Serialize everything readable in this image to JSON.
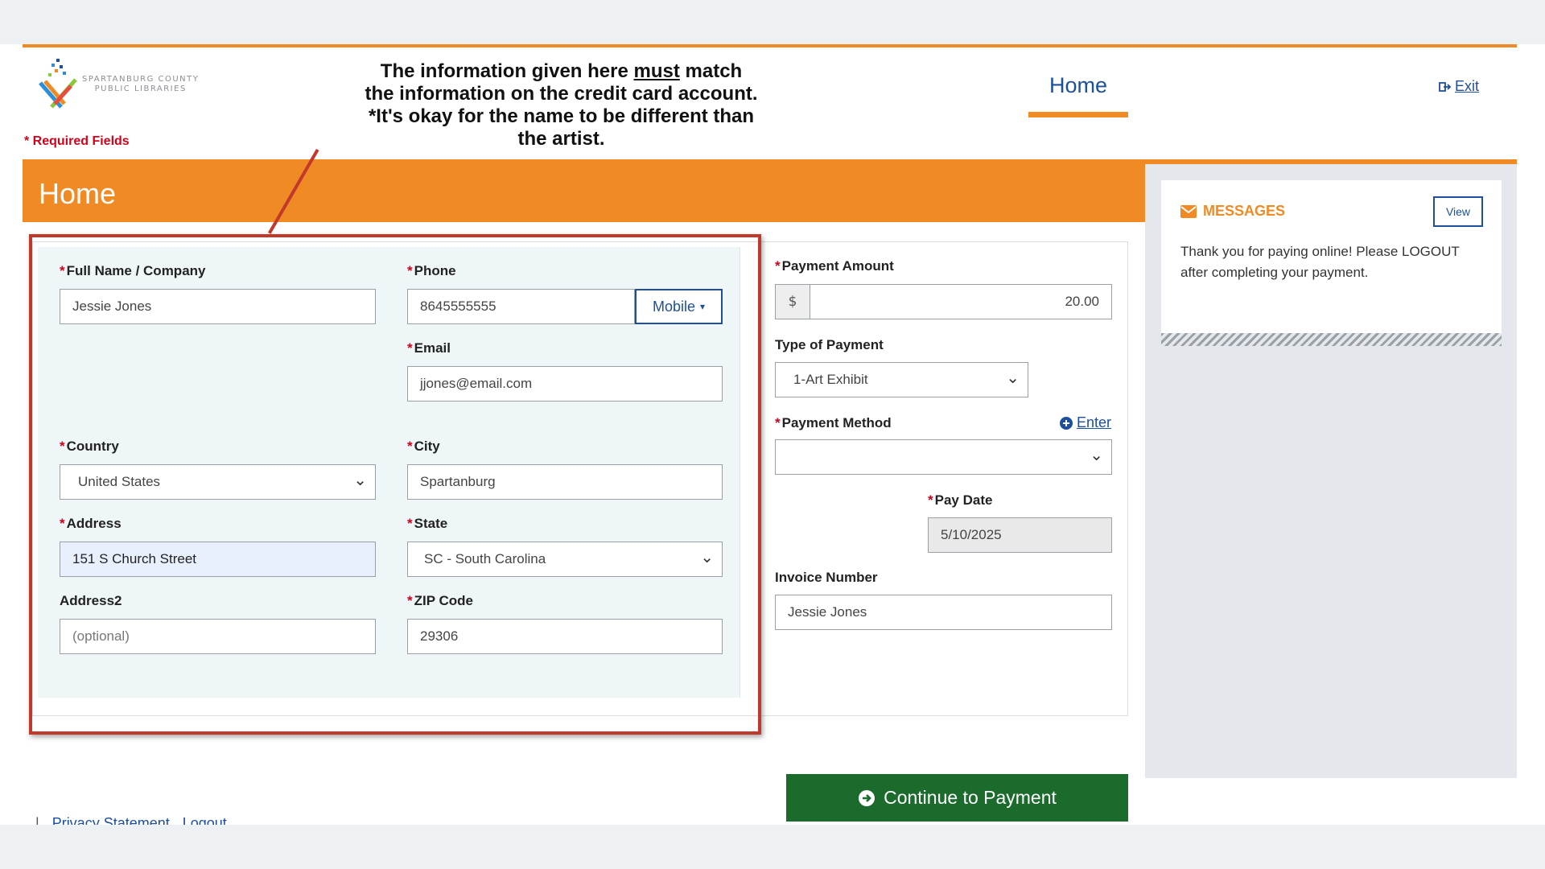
{
  "logo": {
    "line1": "SPARTANBURG COUNTY",
    "line2": "PUBLIC LIBRARIES"
  },
  "required_note": "* Required Fields",
  "callout": {
    "line1_pre": "The information given here ",
    "line1_em": "must",
    "line1_post": " match",
    "line2": "the information on the credit card account.",
    "line3": "*It's okay for the name to be different than",
    "line4": "the artist."
  },
  "nav": {
    "home": "Home",
    "exit": "Exit"
  },
  "banner": {
    "title": "Home"
  },
  "form": {
    "full_name": {
      "label": "Full Name / Company",
      "value": "Jessie Jones"
    },
    "phone": {
      "label": "Phone",
      "value": "8645555555",
      "type": "Mobile"
    },
    "email": {
      "label": "Email",
      "value": "jjones@email.com"
    },
    "country": {
      "label": "Country",
      "value": "United States"
    },
    "city": {
      "label": "City",
      "value": "Spartanburg"
    },
    "address": {
      "label": "Address",
      "value": "151 S Church Street"
    },
    "state": {
      "label": "State",
      "value": "SC - South Carolina"
    },
    "address2": {
      "label": "Address2",
      "placeholder": "(optional)"
    },
    "zip": {
      "label": "ZIP Code",
      "value": "29306"
    },
    "payment_amount": {
      "label": "Payment Amount",
      "currency": "$",
      "value": "20.00"
    },
    "payment_type": {
      "label": "Type of Payment",
      "value": "1-Art Exhibit"
    },
    "payment_method": {
      "label": "Payment Method",
      "value": "",
      "enter_link": "Enter"
    },
    "pay_date": {
      "label": "Pay Date",
      "value": "5/10/2025"
    },
    "invoice": {
      "label": "Invoice Number",
      "value": "Jessie Jones"
    }
  },
  "continue_button": "Continue to Payment",
  "messages": {
    "title": "MESSAGES",
    "view_button": "View",
    "body": "Thank you for paying online! Please LOGOUT after completing your payment."
  },
  "footer": {
    "separator": "|",
    "privacy": "Privacy Statement",
    "logout": "Logout"
  },
  "colors": {
    "accent": "#f08a24",
    "link": "#1d4f9e",
    "required": "#d0021b",
    "primary_button": "#1a6b2c",
    "annotation": "#c0392b"
  }
}
